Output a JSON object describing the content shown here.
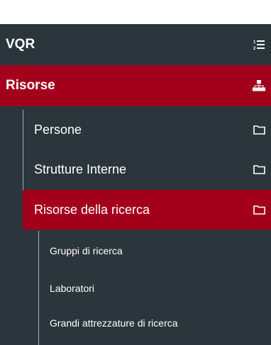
{
  "menu": {
    "vqr": {
      "label": "VQR",
      "icon": "ordered-list-icon"
    },
    "risorse": {
      "label": "Risorse",
      "icon": "sitemap-icon",
      "active_color": "#a3001b"
    },
    "level1": [
      {
        "label": "Persone",
        "icon": "folder-icon"
      },
      {
        "label": "Strutture Interne",
        "icon": "folder-icon"
      },
      {
        "label": "Risorse della ricerca",
        "icon": "folder-icon",
        "active": true
      }
    ],
    "level2": [
      {
        "label": "Gruppi di ricerca"
      },
      {
        "label": "Laboratori"
      },
      {
        "label": "Grandi attrezzature di ricerca"
      }
    ]
  },
  "colors": {
    "panel_bg": "#2b353c",
    "active_bg": "#a3001b",
    "text": "#ffffff",
    "tree_line": "#a7b0b6"
  }
}
